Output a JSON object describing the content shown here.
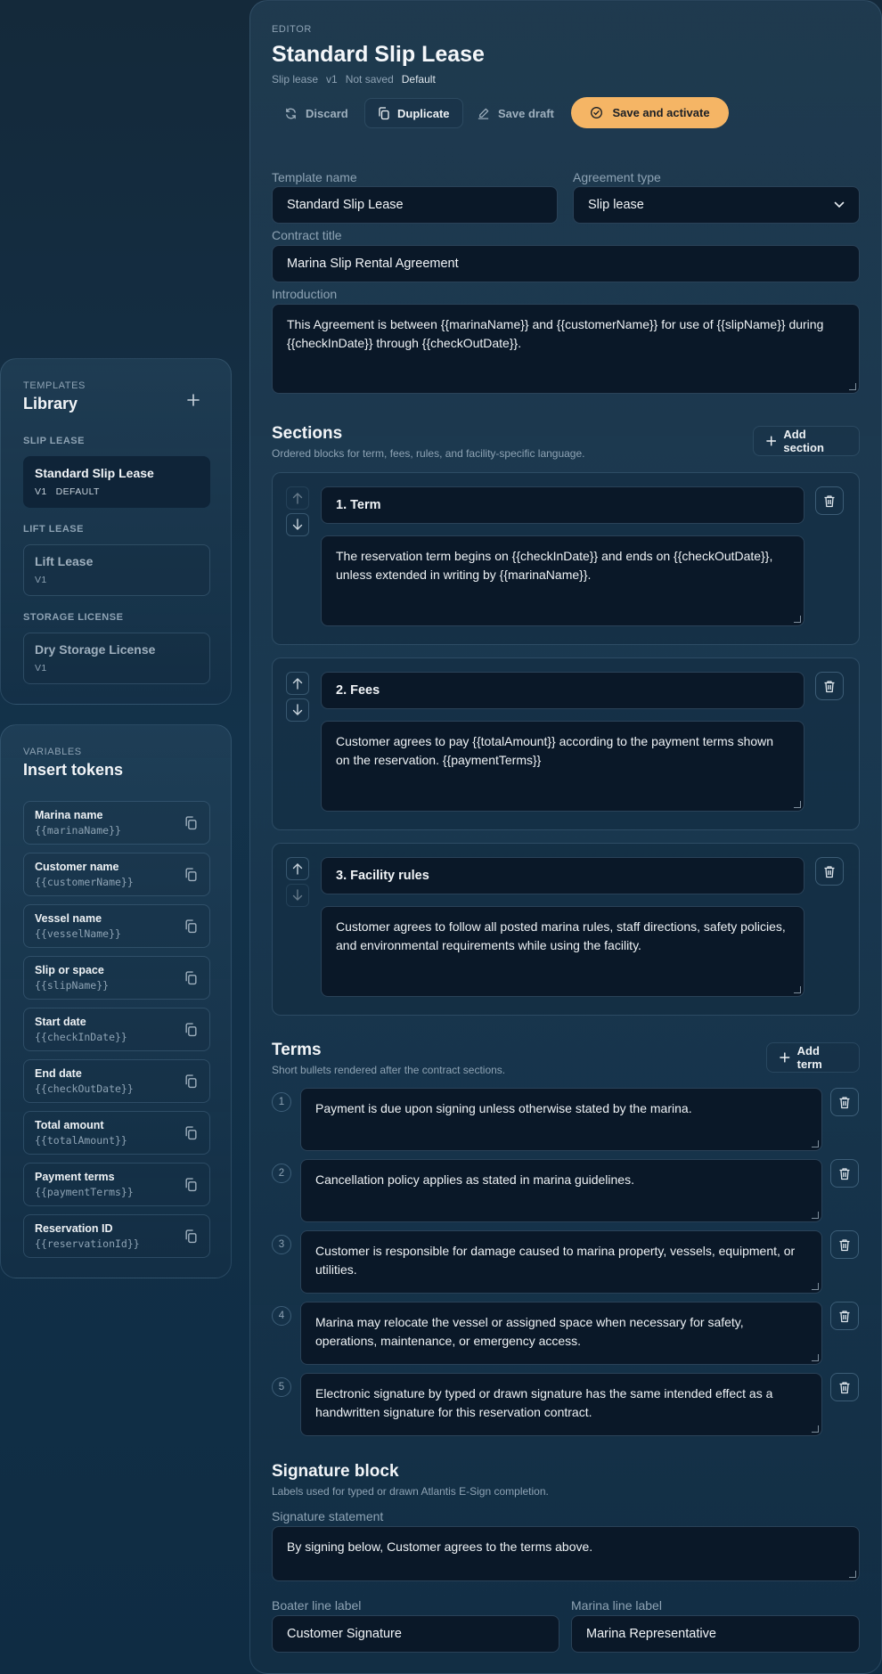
{
  "library": {
    "eyebrow": "TEMPLATES",
    "title": "Library",
    "groups": [
      {
        "label": "SLIP LEASE",
        "items": [
          {
            "name": "Standard Slip Lease",
            "meta": "V1   DEFAULT"
          }
        ]
      },
      {
        "label": "LIFT LEASE",
        "items": [
          {
            "name": "Lift Lease",
            "meta": "V1"
          }
        ]
      },
      {
        "label": "STORAGE LICENSE",
        "items": [
          {
            "name": "Dry Storage License",
            "meta": "V1"
          }
        ]
      }
    ]
  },
  "variables": {
    "eyebrow": "VARIABLES",
    "title": "Insert tokens",
    "tokens": [
      {
        "label": "Marina name",
        "code": "{{marinaName}}"
      },
      {
        "label": "Customer name",
        "code": "{{customerName}}"
      },
      {
        "label": "Vessel name",
        "code": "{{vesselName}}"
      },
      {
        "label": "Slip or space",
        "code": "{{slipName}}"
      },
      {
        "label": "Start date",
        "code": "{{checkInDate}}"
      },
      {
        "label": "End date",
        "code": "{{checkOutDate}}"
      },
      {
        "label": "Total amount",
        "code": "{{totalAmount}}"
      },
      {
        "label": "Payment terms",
        "code": "{{paymentTerms}}"
      },
      {
        "label": "Reservation ID",
        "code": "{{reservationId}}"
      }
    ]
  },
  "editor": {
    "eyebrow": "EDITOR",
    "title": "Standard Slip Lease",
    "meta": {
      "type": "Slip lease",
      "version": "v1",
      "status": "Not saved",
      "flag": "Default"
    },
    "actions": {
      "discard": "Discard",
      "duplicate": "Duplicate",
      "save_draft": "Save draft",
      "save_activate": "Save and activate"
    },
    "accent": "#f5b565"
  },
  "form": {
    "template_name_label": "Template name",
    "template_name_value": "Standard Slip Lease",
    "agreement_type_label": "Agreement type",
    "agreement_type_value": "Slip lease",
    "contract_title_label": "Contract title",
    "contract_title_value": "Marina Slip Rental Agreement",
    "introduction_label": "Introduction",
    "introduction_value": "This Agreement is between {{marinaName}} and {{customerName}} for use of {{slipName}} during {{checkInDate}} through {{checkOutDate}}."
  },
  "sections": {
    "title": "Sections",
    "subtitle": "Ordered blocks for term, fees, rules, and facility-specific language.",
    "add_label": "Add section",
    "items": [
      {
        "heading": "1. Term",
        "body": "The reservation term begins on {{checkInDate}} and ends on {{checkOutDate}}, unless extended in writing by {{marinaName}}."
      },
      {
        "heading": "2. Fees",
        "body": "Customer agrees to pay {{totalAmount}} according to the payment terms shown on the reservation. {{paymentTerms}}"
      },
      {
        "heading": "3. Facility rules",
        "body": "Customer agrees to follow all posted marina rules, staff directions, safety policies, and environmental requirements while using the facility."
      }
    ]
  },
  "terms": {
    "title": "Terms",
    "subtitle": "Short bullets rendered after the contract sections.",
    "add_label": "Add term",
    "items": [
      {
        "num": "1",
        "text": "Payment is due upon signing unless otherwise stated by the marina."
      },
      {
        "num": "2",
        "text": "Cancellation policy applies as stated in marina guidelines."
      },
      {
        "num": "3",
        "text": "Customer is responsible for damage caused to marina property, vessels, equipment, or utilities."
      },
      {
        "num": "4",
        "text": "Marina may relocate the vessel or assigned space when necessary for safety, operations, maintenance, or emergency access."
      },
      {
        "num": "5",
        "text": "Electronic signature by typed or drawn signature has the same intended effect as a handwritten signature for this reservation contract."
      }
    ]
  },
  "signature": {
    "title": "Signature block",
    "subtitle": "Labels used for typed or drawn Atlantis E-Sign completion.",
    "statement_label": "Signature statement",
    "statement_value": "By signing below, Customer agrees to the terms above.",
    "boater_label": "Boater line label",
    "boater_value": "Customer Signature",
    "marina_label": "Marina line label",
    "marina_value": "Marina Representative"
  }
}
